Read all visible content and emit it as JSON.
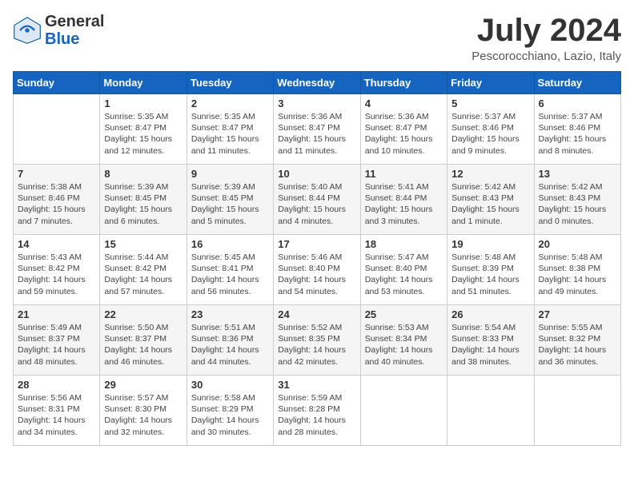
{
  "header": {
    "logo_general": "General",
    "logo_blue": "Blue",
    "title": "July 2024",
    "location": "Pescorocchiano, Lazio, Italy"
  },
  "weekdays": [
    "Sunday",
    "Monday",
    "Tuesday",
    "Wednesday",
    "Thursday",
    "Friday",
    "Saturday"
  ],
  "weeks": [
    [
      {
        "day": "",
        "info": ""
      },
      {
        "day": "1",
        "info": "Sunrise: 5:35 AM\nSunset: 8:47 PM\nDaylight: 15 hours\nand 12 minutes."
      },
      {
        "day": "2",
        "info": "Sunrise: 5:35 AM\nSunset: 8:47 PM\nDaylight: 15 hours\nand 11 minutes."
      },
      {
        "day": "3",
        "info": "Sunrise: 5:36 AM\nSunset: 8:47 PM\nDaylight: 15 hours\nand 11 minutes."
      },
      {
        "day": "4",
        "info": "Sunrise: 5:36 AM\nSunset: 8:47 PM\nDaylight: 15 hours\nand 10 minutes."
      },
      {
        "day": "5",
        "info": "Sunrise: 5:37 AM\nSunset: 8:46 PM\nDaylight: 15 hours\nand 9 minutes."
      },
      {
        "day": "6",
        "info": "Sunrise: 5:37 AM\nSunset: 8:46 PM\nDaylight: 15 hours\nand 8 minutes."
      }
    ],
    [
      {
        "day": "7",
        "info": "Sunrise: 5:38 AM\nSunset: 8:46 PM\nDaylight: 15 hours\nand 7 minutes."
      },
      {
        "day": "8",
        "info": "Sunrise: 5:39 AM\nSunset: 8:45 PM\nDaylight: 15 hours\nand 6 minutes."
      },
      {
        "day": "9",
        "info": "Sunrise: 5:39 AM\nSunset: 8:45 PM\nDaylight: 15 hours\nand 5 minutes."
      },
      {
        "day": "10",
        "info": "Sunrise: 5:40 AM\nSunset: 8:44 PM\nDaylight: 15 hours\nand 4 minutes."
      },
      {
        "day": "11",
        "info": "Sunrise: 5:41 AM\nSunset: 8:44 PM\nDaylight: 15 hours\nand 3 minutes."
      },
      {
        "day": "12",
        "info": "Sunrise: 5:42 AM\nSunset: 8:43 PM\nDaylight: 15 hours\nand 1 minute."
      },
      {
        "day": "13",
        "info": "Sunrise: 5:42 AM\nSunset: 8:43 PM\nDaylight: 15 hours\nand 0 minutes."
      }
    ],
    [
      {
        "day": "14",
        "info": "Sunrise: 5:43 AM\nSunset: 8:42 PM\nDaylight: 14 hours\nand 59 minutes."
      },
      {
        "day": "15",
        "info": "Sunrise: 5:44 AM\nSunset: 8:42 PM\nDaylight: 14 hours\nand 57 minutes."
      },
      {
        "day": "16",
        "info": "Sunrise: 5:45 AM\nSunset: 8:41 PM\nDaylight: 14 hours\nand 56 minutes."
      },
      {
        "day": "17",
        "info": "Sunrise: 5:46 AM\nSunset: 8:40 PM\nDaylight: 14 hours\nand 54 minutes."
      },
      {
        "day": "18",
        "info": "Sunrise: 5:47 AM\nSunset: 8:40 PM\nDaylight: 14 hours\nand 53 minutes."
      },
      {
        "day": "19",
        "info": "Sunrise: 5:48 AM\nSunset: 8:39 PM\nDaylight: 14 hours\nand 51 minutes."
      },
      {
        "day": "20",
        "info": "Sunrise: 5:48 AM\nSunset: 8:38 PM\nDaylight: 14 hours\nand 49 minutes."
      }
    ],
    [
      {
        "day": "21",
        "info": "Sunrise: 5:49 AM\nSunset: 8:37 PM\nDaylight: 14 hours\nand 48 minutes."
      },
      {
        "day": "22",
        "info": "Sunrise: 5:50 AM\nSunset: 8:37 PM\nDaylight: 14 hours\nand 46 minutes."
      },
      {
        "day": "23",
        "info": "Sunrise: 5:51 AM\nSunset: 8:36 PM\nDaylight: 14 hours\nand 44 minutes."
      },
      {
        "day": "24",
        "info": "Sunrise: 5:52 AM\nSunset: 8:35 PM\nDaylight: 14 hours\nand 42 minutes."
      },
      {
        "day": "25",
        "info": "Sunrise: 5:53 AM\nSunset: 8:34 PM\nDaylight: 14 hours\nand 40 minutes."
      },
      {
        "day": "26",
        "info": "Sunrise: 5:54 AM\nSunset: 8:33 PM\nDaylight: 14 hours\nand 38 minutes."
      },
      {
        "day": "27",
        "info": "Sunrise: 5:55 AM\nSunset: 8:32 PM\nDaylight: 14 hours\nand 36 minutes."
      }
    ],
    [
      {
        "day": "28",
        "info": "Sunrise: 5:56 AM\nSunset: 8:31 PM\nDaylight: 14 hours\nand 34 minutes."
      },
      {
        "day": "29",
        "info": "Sunrise: 5:57 AM\nSunset: 8:30 PM\nDaylight: 14 hours\nand 32 minutes."
      },
      {
        "day": "30",
        "info": "Sunrise: 5:58 AM\nSunset: 8:29 PM\nDaylight: 14 hours\nand 30 minutes."
      },
      {
        "day": "31",
        "info": "Sunrise: 5:59 AM\nSunset: 8:28 PM\nDaylight: 14 hours\nand 28 minutes."
      },
      {
        "day": "",
        "info": ""
      },
      {
        "day": "",
        "info": ""
      },
      {
        "day": "",
        "info": ""
      }
    ]
  ]
}
